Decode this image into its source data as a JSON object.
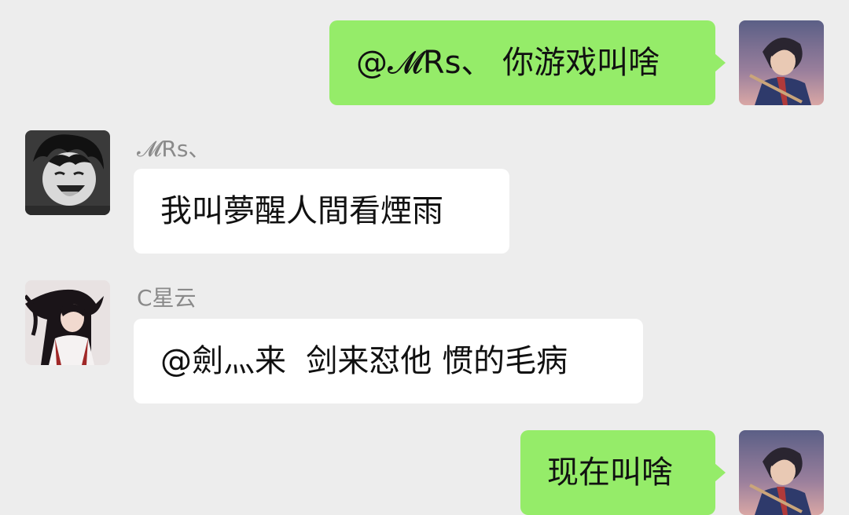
{
  "messages": [
    {
      "id": "m1",
      "side": "mine",
      "text": "@𝓜Rs、 你游戏叫啥",
      "avatar": "self-avatar"
    },
    {
      "id": "m2",
      "side": "theirs",
      "sender": "𝓜Rs、",
      "text": "我叫夢醒人間看煙雨",
      "avatar": "mrs-avatar"
    },
    {
      "id": "m3",
      "side": "theirs",
      "sender": "C星云",
      "text": "@劍灬来  剑来怼他 惯的毛病",
      "avatar": "xingyun-avatar"
    },
    {
      "id": "m4",
      "side": "mine",
      "text": "现在叫啥",
      "avatar": "self-avatar"
    }
  ],
  "colors": {
    "background": "#ededed",
    "mine_bubble": "#95ec69",
    "theirs_bubble": "#ffffff",
    "sender_name": "#8a8a8a"
  }
}
